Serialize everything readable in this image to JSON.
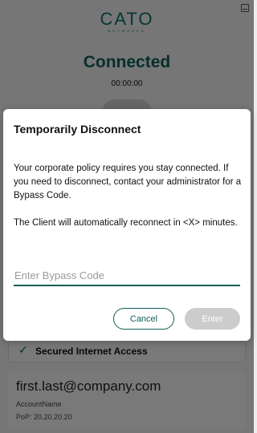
{
  "app": {
    "logo_text": "CATO",
    "logo_subtext": "NETWORKS",
    "status": "Connected",
    "timer": "00:00:00",
    "services": {
      "secured_internet_access": "Secured Internet Access"
    },
    "account": {
      "email": "first.last@company.com",
      "account_name": "AccountName",
      "pop": "PoP: 20.20.20.20"
    }
  },
  "dialog": {
    "title": "Temporarily Disconnect",
    "message_1": "Your corporate policy requires you stay connected. If you need to disconnect, contact your administrator for a Bypass Code.",
    "message_2": "The Client will automatically reconnect in <X> minutes.",
    "bypass_input": {
      "placeholder": "Enter Bypass Code",
      "value": ""
    },
    "cancel_label": "Cancel",
    "enter_label": "Enter"
  },
  "colors": {
    "accent": "#0e5f58",
    "disabled_button": "#cccccc",
    "overlay": "rgba(0,0,0,0.5)"
  }
}
